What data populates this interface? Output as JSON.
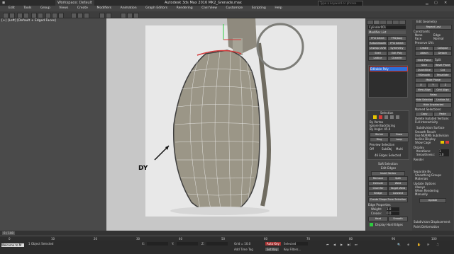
{
  "titlebar": {
    "workspace": "Workspace: Default",
    "app_title": "Autodesk 3ds Max 2016    MK2_Grenade.max",
    "search_placeholder": "Type a keyword or phrase"
  },
  "menu": [
    "Edit",
    "Tools",
    "Group",
    "Views",
    "Create",
    "Modifiers",
    "Animation",
    "Graph Editors",
    "Rendering",
    "Civil View",
    "Customize",
    "Scripting",
    "Help"
  ],
  "viewport_left": {
    "label": "[+] [Left] [Default + Edged Faces]"
  },
  "viewport_main": {
    "annotation": "DY"
  },
  "panel": {
    "header": "Edit Geometry",
    "object_name": "Cylinder001",
    "modifier_list": "Modifier List",
    "stack_item": "Editable Poly",
    "buttons_col1": [
      "FFD Select",
      "TurboSmooth",
      "Unwrap UVW",
      "Shell",
      "Lattice"
    ],
    "buttons_col2": [
      "FFD(box)",
      "FFD Select",
      "Symmetry",
      "Edit Poly",
      "Chamfer"
    ],
    "selection_title": "Selection",
    "selection_items": [
      "By Vertex",
      "Ignore Backfacing",
      "By Angle: 45.0",
      "Shrink",
      "Grow",
      "Ring",
      "Loop"
    ],
    "preview_selection": "Preview Selection",
    "preview_opts": [
      "Off",
      "SubObj",
      "Multi"
    ],
    "selected_count": "46 Edges Selected",
    "soft_selection": "Soft Selection",
    "edit_edges": "Edit Edges",
    "insert_vertex": "Insert Vertex",
    "edit_buttons": [
      "Remove",
      "Split",
      "Extrude",
      "Weld",
      "Chamfer",
      "Target Weld",
      "Bridge",
      "Connect"
    ],
    "create_shape": "Create Shape From Selection",
    "edge_properties": "Edge Properties",
    "weight_label": "Weight:",
    "weight_val": "1.0",
    "crease_label": "Crease:",
    "crease_val": "0.0",
    "hard": "Hard",
    "smooth": "Smooth",
    "display_hard": "Display Hard Edges",
    "right_col": [
      "Repeat Last",
      "Constraints",
      "None",
      "Edge",
      "Face",
      "Normal",
      "Preserve UVs",
      "Create",
      "Collapse",
      "Attach",
      "Detach",
      "Slice Plane",
      "Split",
      "Slice",
      "Reset Plane",
      "QuickSlice",
      "Cut",
      "MSmooth",
      "Tessellate",
      "Make Planar",
      "X",
      "Y",
      "Z",
      "View Align",
      "Grid Align",
      "Relax",
      "Hide Selected",
      "Unhide All",
      "Hide Unselected",
      "Named Selections:",
      "Copy",
      "Paste",
      "Delete Isolated Vertices",
      "Full Interactivity"
    ],
    "subdiv_surface": "Subdivision Surface",
    "subdiv_items": [
      "Smooth Result",
      "Use NURMS Subdivision",
      "Isoline Display",
      "Show Cage"
    ],
    "display": "Display",
    "iterations_label": "Iterations:",
    "iterations_val": "1",
    "smoothness_label": "Smoothness:",
    "smoothness_val": "1.0",
    "render": "Render",
    "separate_by": "Separate By",
    "smoothing_groups": "Smoothing Groups",
    "materials": "Materials",
    "update_options": "Update Options",
    "update_opts": [
      "Always",
      "When Rendering",
      "Manually"
    ],
    "update_btn": "Update",
    "subdiv_disp": "Subdivision Displacement",
    "paint_deform": "Paint Deformation"
  },
  "timeline": {
    "frame": "0 / 100",
    "ticks": [
      "0",
      "10",
      "20",
      "30",
      "40",
      "50",
      "60",
      "70",
      "80",
      "90",
      "100"
    ]
  },
  "status": {
    "left": "Welcome to M",
    "selected": "1 Object Selected",
    "x_label": "X:",
    "y_label": "Y:",
    "z_label": "Z:",
    "grid": "Grid = 10.0",
    "autokey": "Auto Key",
    "selected_dd": "Selected",
    "setkey": "Set Key",
    "keyfilters": "Key Filters...",
    "add_time_tag": "Add Time Tag"
  },
  "colors": {
    "accent_red": "#d43a3a",
    "accent_yellow": "#e6c400",
    "accent_green": "#2ecc40",
    "accent_blue": "#2a6fdb",
    "selection_white": "#ffffff"
  }
}
